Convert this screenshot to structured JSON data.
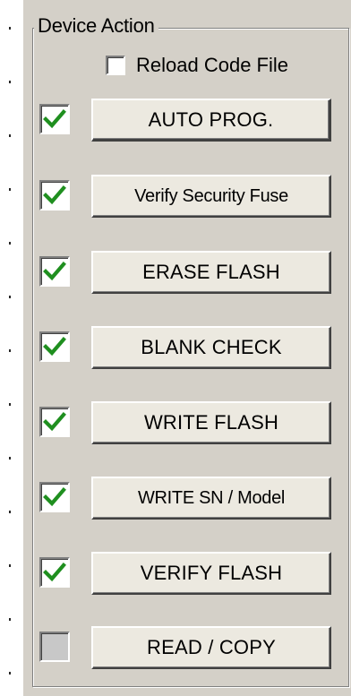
{
  "group": {
    "title": "Device Action"
  },
  "reload": {
    "label": "Reload Code File",
    "checked": false
  },
  "actions": [
    {
      "label": "AUTO PROG.",
      "checked": true
    },
    {
      "label": "Verify Security Fuse",
      "checked": true
    },
    {
      "label": "ERASE FLASH",
      "checked": true
    },
    {
      "label": "BLANK CHECK",
      "checked": true
    },
    {
      "label": "WRITE FLASH",
      "checked": true
    },
    {
      "label": "WRITE SN / Model",
      "checked": true
    },
    {
      "label": "VERIFY FLASH",
      "checked": true
    },
    {
      "label": "READ / COPY",
      "checked": false
    }
  ],
  "colors": {
    "check": "#1f8f1f",
    "panel": "#d4d0c8",
    "button_face": "#ece9e0"
  },
  "icons": {
    "check": "checkmark-icon"
  }
}
